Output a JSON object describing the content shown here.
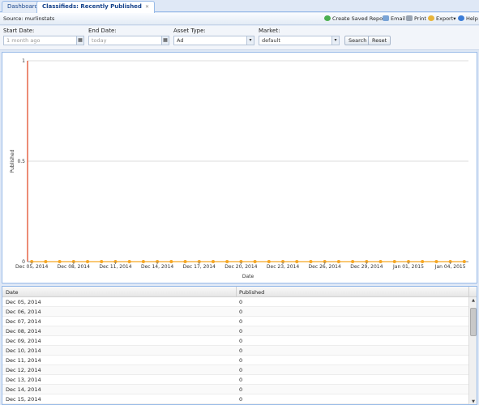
{
  "tabs": [
    {
      "label": "Dashboard",
      "active": false
    },
    {
      "label": "Classifieds: Recently Published",
      "active": true
    }
  ],
  "toolbar": {
    "source": "Source: murlinstats",
    "create_saved_report": "Create Saved Report",
    "email": "Email",
    "print": "Print",
    "export": "Export",
    "help": "Help"
  },
  "filters": {
    "start_date": {
      "label": "Start Date:",
      "placeholder": "1 month ago"
    },
    "end_date": {
      "label": "End Date:",
      "placeholder": "today"
    },
    "asset_type": {
      "label": "Asset Type:",
      "value": "Ad"
    },
    "market": {
      "label": "Market:",
      "value": "default"
    },
    "search_label": "Search",
    "reset_label": "Reset"
  },
  "colors": {
    "series": "#f5a623",
    "y_axis": "#e0401a",
    "grid": "#dddddd"
  },
  "chart_data": {
    "type": "line",
    "xlabel": "Date",
    "ylabel": "Published",
    "ylim": [
      0,
      1
    ],
    "y_ticks": [
      "0",
      "0.5",
      "1"
    ],
    "x_tick_labels": [
      "Dec 05, 2014",
      "Dec 08, 2014",
      "Dec 11, 2014",
      "Dec 14, 2014",
      "Dec 17, 2014",
      "Dec 20, 2014",
      "Dec 23, 2014",
      "Dec 26, 2014",
      "Dec 29, 2014",
      "Jan 01, 2015",
      "Jan 04, 2015"
    ],
    "x": [
      "Dec 05, 2014",
      "Dec 06, 2014",
      "Dec 07, 2014",
      "Dec 08, 2014",
      "Dec 09, 2014",
      "Dec 10, 2014",
      "Dec 11, 2014",
      "Dec 12, 2014",
      "Dec 13, 2014",
      "Dec 14, 2014",
      "Dec 15, 2014",
      "Dec 16, 2014",
      "Dec 17, 2014",
      "Dec 18, 2014",
      "Dec 19, 2014",
      "Dec 20, 2014",
      "Dec 21, 2014",
      "Dec 22, 2014",
      "Dec 23, 2014",
      "Dec 24, 2014",
      "Dec 25, 2014",
      "Dec 26, 2014",
      "Dec 27, 2014",
      "Dec 28, 2014",
      "Dec 29, 2014",
      "Dec 30, 2014",
      "Dec 31, 2014",
      "Jan 01, 2015",
      "Jan 02, 2015",
      "Jan 03, 2015",
      "Jan 04, 2015",
      "Jan 05, 2015"
    ],
    "series": [
      {
        "values": [
          0,
          0,
          0,
          0,
          0,
          0,
          0,
          0,
          0,
          0,
          0,
          0,
          0,
          0,
          0,
          0,
          0,
          0,
          0,
          0,
          0,
          0,
          0,
          0,
          0,
          0,
          0,
          0,
          0,
          0,
          0,
          0
        ]
      }
    ]
  },
  "grid": {
    "columns": [
      "Date",
      "Published"
    ],
    "rows": [
      {
        "date": "Dec 05, 2014",
        "published": "0"
      },
      {
        "date": "Dec 06, 2014",
        "published": "0"
      },
      {
        "date": "Dec 07, 2014",
        "published": "0"
      },
      {
        "date": "Dec 08, 2014",
        "published": "0"
      },
      {
        "date": "Dec 09, 2014",
        "published": "0"
      },
      {
        "date": "Dec 10, 2014",
        "published": "0"
      },
      {
        "date": "Dec 11, 2014",
        "published": "0"
      },
      {
        "date": "Dec 12, 2014",
        "published": "0"
      },
      {
        "date": "Dec 13, 2014",
        "published": "0"
      },
      {
        "date": "Dec 14, 2014",
        "published": "0"
      },
      {
        "date": "Dec 15, 2014",
        "published": "0"
      }
    ]
  }
}
